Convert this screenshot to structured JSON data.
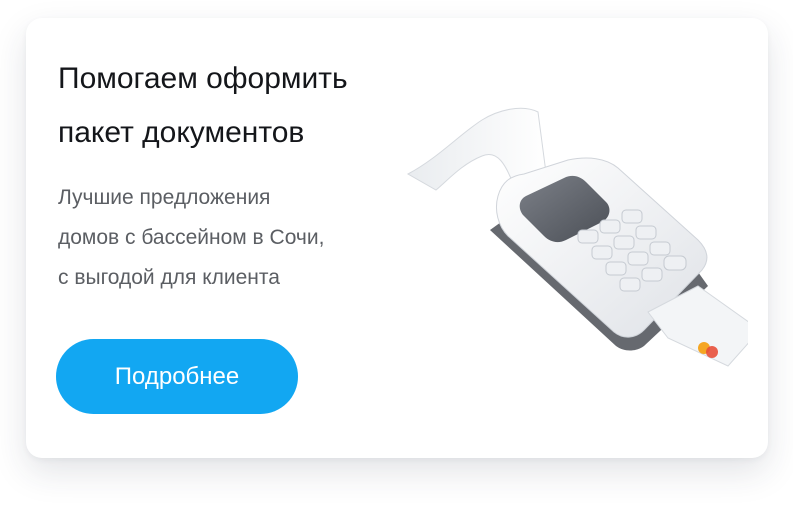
{
  "banner": {
    "title_line1": "Помогаем оформить",
    "title_line2": "пакет документов",
    "subtitle_line1": "Лучшие предложения",
    "subtitle_line2": "домов с бассейном в Сочи,",
    "subtitle_line3": "с выгодой для клиента",
    "cta_label": "Подробнее"
  },
  "colors": {
    "cta_background": "#12a7f2",
    "cta_text": "#ffffff",
    "title_text": "#14161a",
    "subtitle_text": "#5b5e63"
  },
  "illustration": {
    "icon": "payment-terminal-icon"
  }
}
